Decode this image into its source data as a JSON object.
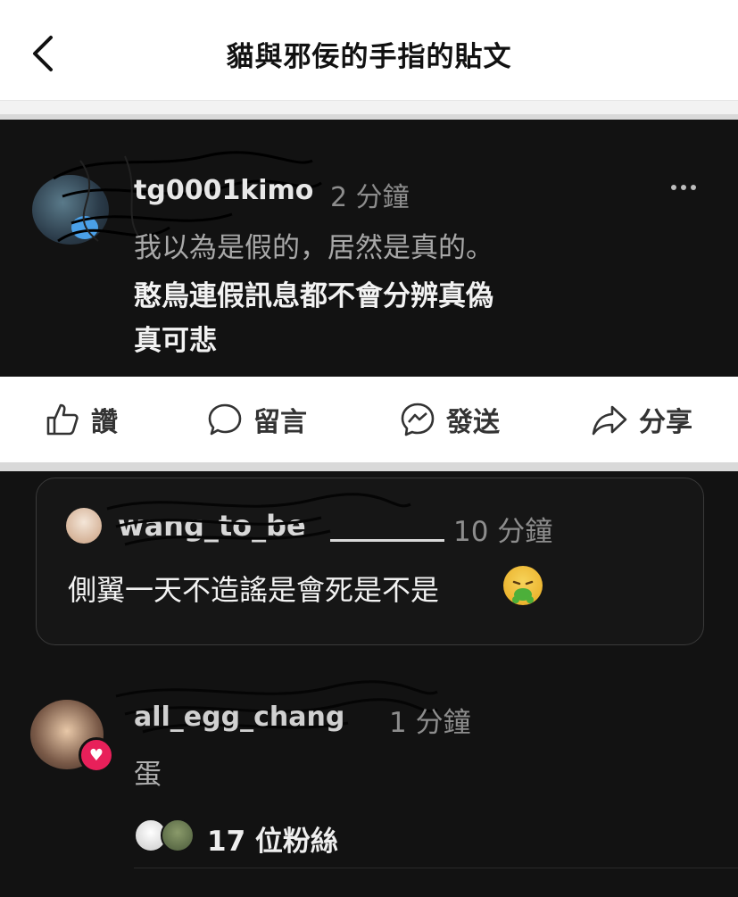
{
  "header": {
    "title": "貓與邪佞的手指的貼文",
    "back_icon": "chevron-left-icon"
  },
  "post": {
    "username": "tg0001kimo",
    "time": "2 分鐘",
    "line1": "我以為是假的，居然是真的。",
    "line2": "憨鳥連假訊息都不會分辨真偽",
    "line3": "真可悲"
  },
  "actions": [
    {
      "label": "讚",
      "icon": "thumbs-up-icon"
    },
    {
      "label": "留言",
      "icon": "comment-bubble-icon"
    },
    {
      "label": "發送",
      "icon": "messenger-icon"
    },
    {
      "label": "分享",
      "icon": "share-arrow-icon"
    }
  ],
  "quote": {
    "username": "wang_to_be",
    "time": "10 分鐘",
    "text": "側翼一天不造謠是會死是不是"
  },
  "reply": {
    "username": "all_egg_chang",
    "time": "1 分鐘",
    "text": "蛋",
    "followers": "17 位粉絲"
  },
  "colors": {
    "background_dark": "#121212",
    "heart_badge": "#e8205a"
  }
}
